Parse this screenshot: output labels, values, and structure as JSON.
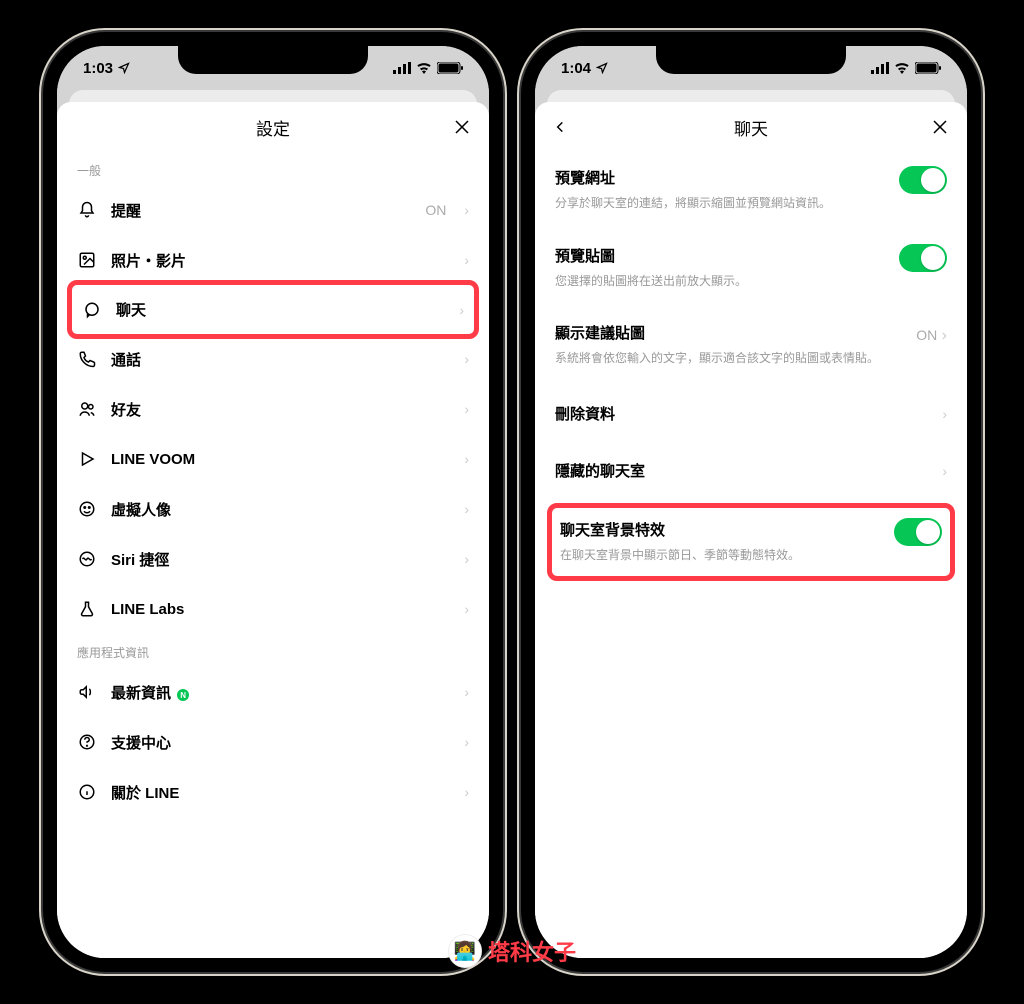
{
  "watermark": "塔科女子",
  "phone_left": {
    "status_time": "1:03",
    "header_title": "設定",
    "section_general": "一般",
    "section_app_info": "應用程式資訊",
    "items": {
      "notify": {
        "label": "提醒",
        "value": "ON"
      },
      "photos": {
        "label": "照片・影片"
      },
      "chat": {
        "label": "聊天"
      },
      "call": {
        "label": "通話"
      },
      "friends": {
        "label": "好友"
      },
      "voom": {
        "label": "LINE VOOM"
      },
      "avatar": {
        "label": "虛擬人像"
      },
      "siri": {
        "label": "Siri 捷徑"
      },
      "labs": {
        "label": "LINE Labs"
      },
      "news": {
        "label": "最新資訊"
      },
      "support": {
        "label": "支援中心"
      },
      "about": {
        "label": "關於 LINE"
      }
    }
  },
  "phone_right": {
    "status_time": "1:04",
    "header_title": "聊天",
    "blocks": {
      "preview_url": {
        "title": "預覽網址",
        "desc": "分享於聊天室的連結，將顯示縮圖並預覽網站資訊。"
      },
      "preview_sticker": {
        "title": "預覽貼圖",
        "desc": "您選擇的貼圖將在送出前放大顯示。"
      },
      "suggest_sticker": {
        "title": "顯示建議貼圖",
        "desc": "系統將會依您輸入的文字，顯示適合該文字的貼圖或表情貼。",
        "value": "ON"
      },
      "delete_data": {
        "title": "刪除資料"
      },
      "hidden_chats": {
        "title": "隱藏的聊天室"
      },
      "bg_effects": {
        "title": "聊天室背景特效",
        "desc": "在聊天室背景中顯示節日、季節等動態特效。"
      }
    }
  }
}
